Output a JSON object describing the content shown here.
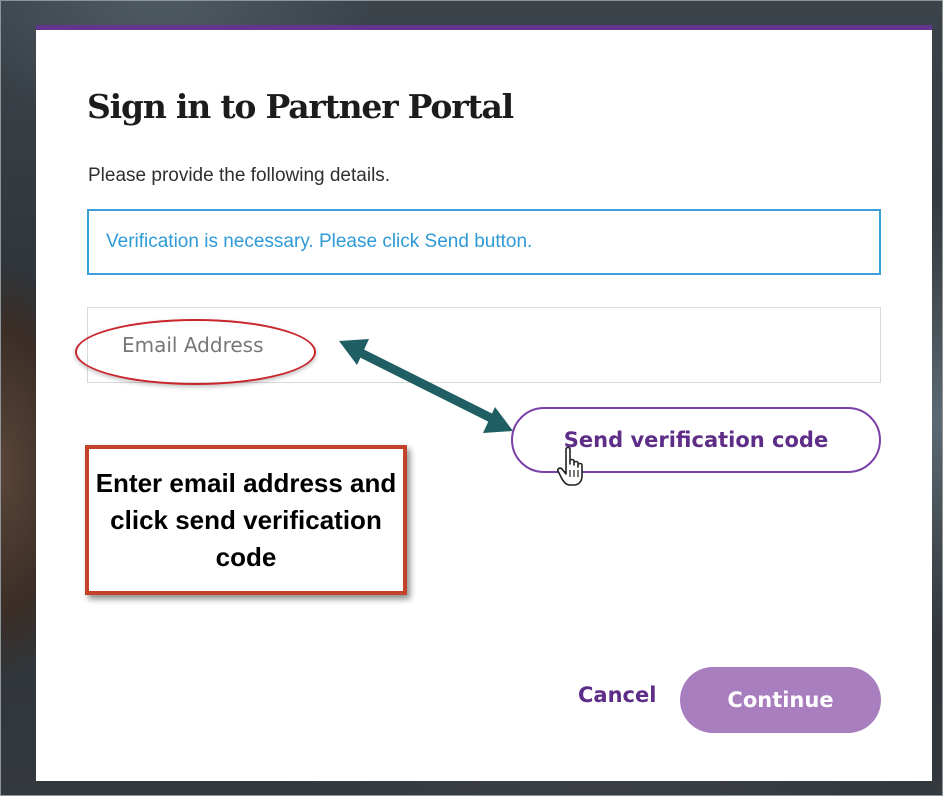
{
  "dialog": {
    "title": "Sign in to Partner Portal",
    "intro": "Please provide the following details.",
    "info_message": "Verification is necessary. Please click Send button.",
    "email_placeholder": "Email Address",
    "send_label": "Send verification code",
    "cancel_label": "Cancel",
    "continue_label": "Continue"
  },
  "annotation": {
    "callout_text": "Enter email address and click send verification code"
  },
  "colors": {
    "accent_purple": "#63358f",
    "info_blue": "#2e9ad6",
    "continue_bg": "#a97ebf",
    "highlight_red": "#c8262c",
    "arrow_teal": "#1f5f63"
  },
  "icons": {
    "cursor": "hand-pointer-icon",
    "arrow": "double-arrow-icon"
  }
}
